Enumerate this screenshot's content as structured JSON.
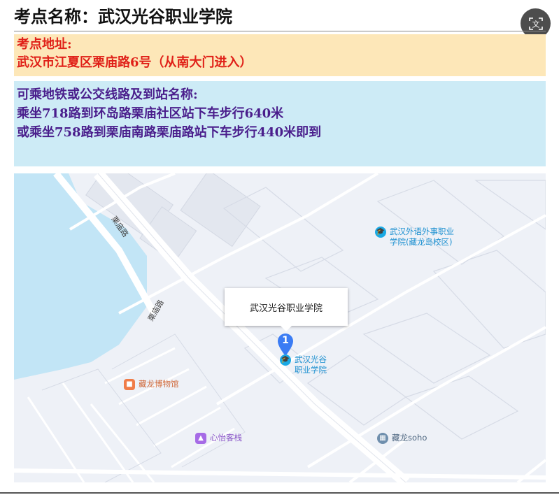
{
  "title": "考点名称：武汉光谷职业学院",
  "translate_icon_glyph": "文",
  "address": {
    "label": "考点地址:",
    "value": "武汉市江夏区栗庙路6号（从南大门进入）"
  },
  "transit": {
    "label": "可乘地铁或公交线路及到站名称:",
    "route1": "乘坐718路到环岛路栗庙社区站下车步行640米",
    "route2": "或乘坐758路到栗庙南路栗庙路站下车步行440米即到"
  },
  "map": {
    "popup_label": "武汉光谷职业学院",
    "marker_number": "1",
    "roads": {
      "upper": "栗庙路",
      "lower": "栗庙路"
    },
    "pois": {
      "school": {
        "line1": "武汉光谷",
        "line2": "职业学院",
        "icon": "school-icon",
        "color": "#1aa9e4"
      },
      "foreign_lang": {
        "line1": "武汉外语外事职业",
        "line2": "学院(藏龙岛校区)",
        "icon": "school-icon",
        "color": "#1aa9e4"
      },
      "museum": {
        "label": "藏龙博物馆",
        "icon": "museum-icon",
        "color": "#f07c48"
      },
      "inn": {
        "label": "心怡客栈",
        "icon": "hotel-icon",
        "color": "#a66be6"
      },
      "office": {
        "label": "藏龙soho",
        "icon": "building-icon",
        "color": "#6f8fad"
      }
    },
    "colors": {
      "water": "#c2e5f6",
      "land": "#eef1f7",
      "road": "#ffffff",
      "block_outline": "#d6dbe6",
      "marker": "#3b7cf4"
    }
  }
}
